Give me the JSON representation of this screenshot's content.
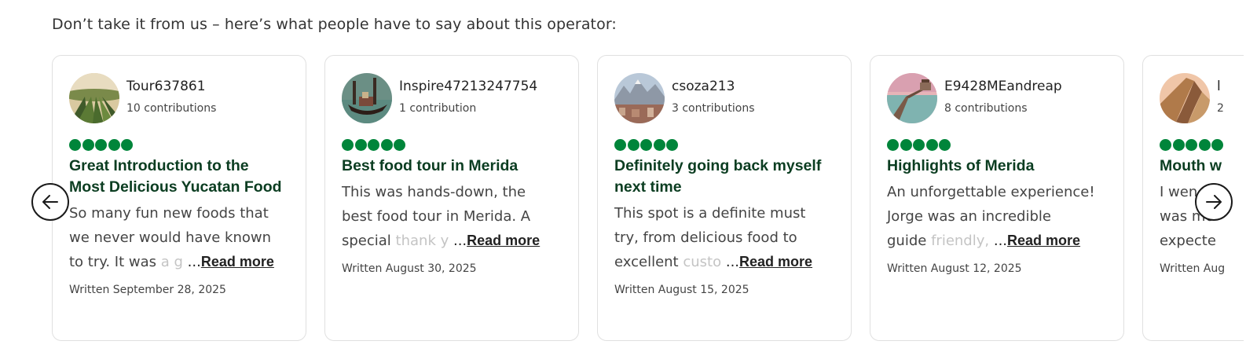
{
  "intro": "Don’t take it from us – here’s what people have to say about this operator:",
  "nav": {
    "prev_icon": "arrow-left-icon",
    "next_icon": "arrow-right-icon"
  },
  "rating_color": "#00853a",
  "reviews": [
    {
      "username": "Tour637861",
      "contributions": "10 contributions",
      "rating": 5,
      "title_lines": [
        "Great Introduction to the",
        "Most Delicious Yucatan Food"
      ],
      "body_lines": [
        "So many fun new foods that",
        "we never would have known"
      ],
      "body_last": "to try. It was",
      "body_fade": "a g",
      "read_more_prefix": "...",
      "read_more": "Read more",
      "written": "Written September 28, 2025"
    },
    {
      "username": "Inspire47213247754",
      "contributions": "1 contribution",
      "rating": 5,
      "title_lines": [
        "Best food tour in Merida"
      ],
      "body_lines": [
        "This was hands-down, the",
        "best food tour in Merida. A"
      ],
      "body_last": "special",
      "body_fade": "thank y",
      "read_more_prefix": "...",
      "read_more": "Read more",
      "written": "Written August 30, 2025"
    },
    {
      "username": "csoza213",
      "contributions": "3 contributions",
      "rating": 5,
      "title_lines": [
        "Definitely going back myself",
        "next time"
      ],
      "body_lines": [
        "This spot is a definite must",
        "try, from delicious food to"
      ],
      "body_last": "excellent",
      "body_fade": "custo",
      "read_more_prefix": "...",
      "read_more": "Read more",
      "written": "Written August 15, 2025"
    },
    {
      "username": "E9428MEandreap",
      "contributions": "8 contributions",
      "rating": 5,
      "title_lines": [
        "Highlights of Merida"
      ],
      "body_lines": [
        "An unforgettable experience!",
        "Jorge was an incredible"
      ],
      "body_last": "guide",
      "body_fade": "friendly,",
      "read_more_prefix": "...",
      "read_more": "Read more",
      "written": "Written August 12, 2025"
    },
    {
      "username": "l",
      "contributions": "2",
      "rating": 5,
      "title_lines": [
        "Mouth w"
      ],
      "body_lines": [
        "I wen",
        "was mo"
      ],
      "body_last": "expecte",
      "body_fade": "",
      "read_more_prefix": "",
      "read_more": "",
      "written": "Written Aug"
    }
  ]
}
